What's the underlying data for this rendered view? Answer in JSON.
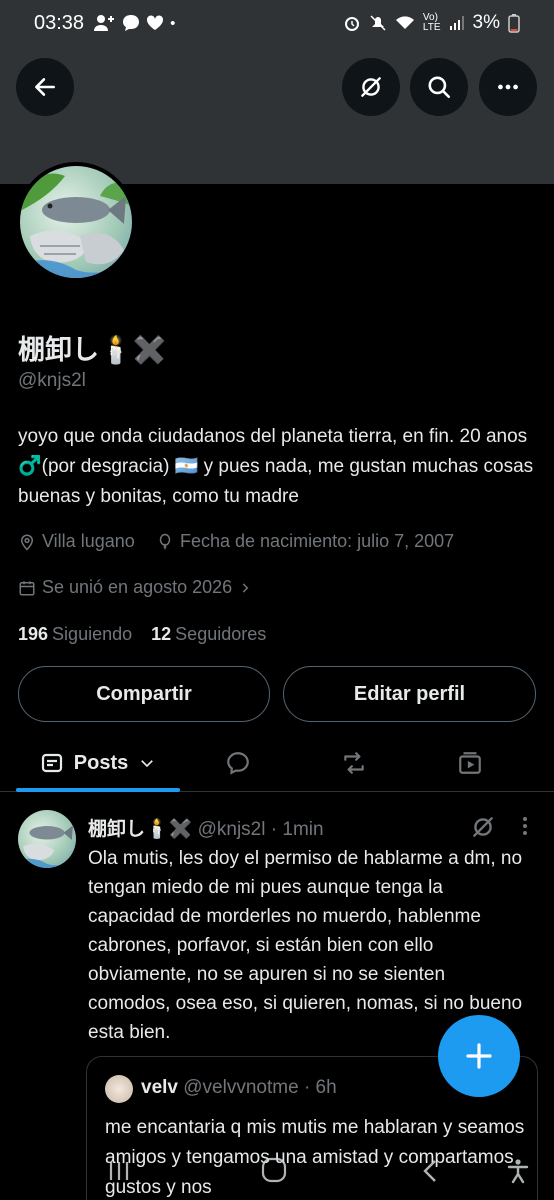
{
  "status_bar": {
    "time": "03:38",
    "battery": "3%"
  },
  "profile": {
    "name": "棚卸し🕯️✖️",
    "handle": "@knjs2l",
    "bio": "yoyo que onda ciudadanos del planeta tierra, en fin. 20 anos ♂️(por desgracia) 🇦🇷 y pues nada, me gustan muchas cosas buenas y bonitas, como tu madre",
    "location": "Villa lugano",
    "birthday": "Fecha de nacimiento: julio 7, 2007",
    "joined": "Se unió en agosto 2026",
    "following_count": "196",
    "following_label": "Siguiendo",
    "followers_count": "12",
    "followers_label": "Seguidores"
  },
  "buttons": {
    "share": "Compartir",
    "edit": "Editar perfil"
  },
  "tabs": {
    "posts_label": "Posts"
  },
  "post": {
    "name": "棚卸し🕯️✖️",
    "handle": "@knjs2l",
    "time": "· 1min",
    "text": "Ola mutis, les doy el permiso de hablarme a dm, no tengan miedo de mi pues aunque tenga la capacidad de morderles no muerdo, hablenme cabrones, porfavor, si están bien con ello obviamente,  no se apuren si no se sienten comodos, osea eso, si quieren, nomas, si no bueno esta bien."
  },
  "quote": {
    "name": "velv",
    "handle": "@velvvnotme",
    "time": "· 6h",
    "text": "me encantaria q mis mutis me hablaran y seamos amigos y tengamos una amistad y compartamos gustos y nos"
  },
  "colors": {
    "accent": "#1d9bf0",
    "background": "#000000",
    "banner": "#2f3336",
    "muted_text": "#71767b"
  }
}
